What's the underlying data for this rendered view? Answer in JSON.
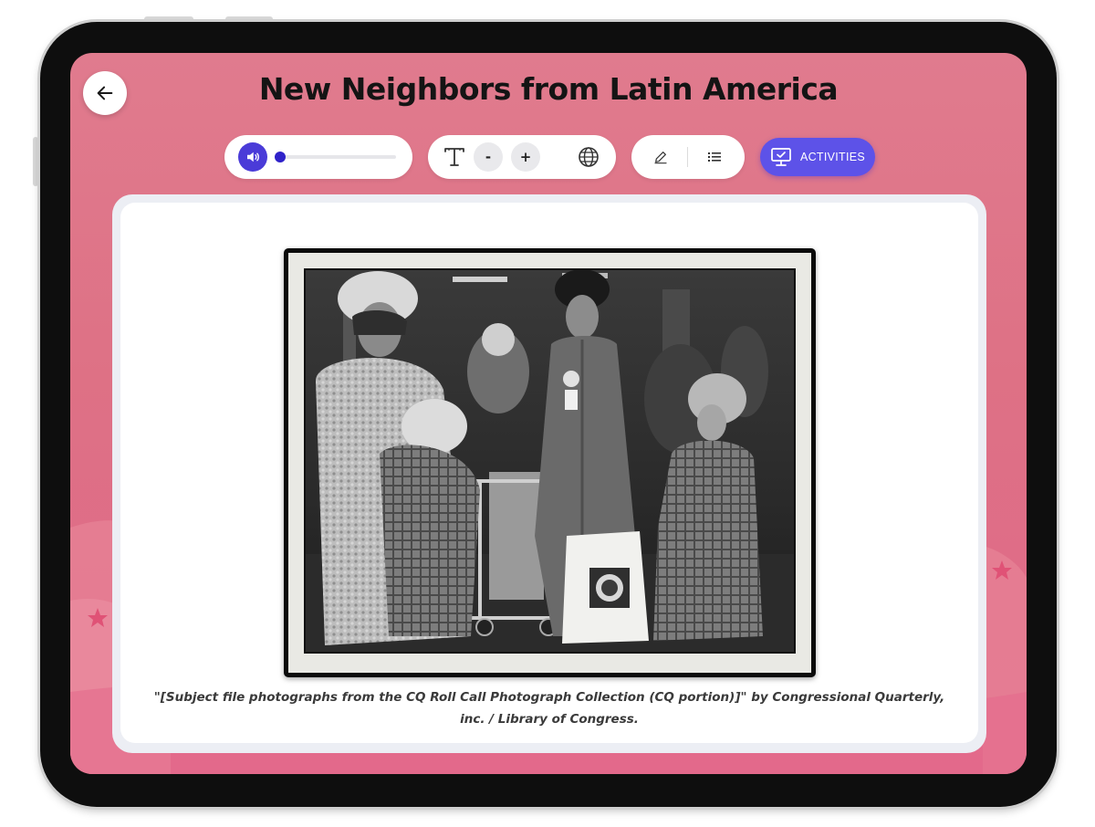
{
  "page": {
    "title": "New Neighbors from Latin America"
  },
  "header": {
    "back_icon": "arrow-left-icon"
  },
  "toolbar": {
    "audio": {
      "play_icon": "speaker-icon",
      "progress": 0.02
    },
    "text_controls": {
      "text_size_icon": "text-size-icon",
      "decrease_label": "-",
      "increase_label": "+",
      "language_icon": "globe-icon"
    },
    "tools": {
      "highlight_icon": "pencil-icon",
      "outline_icon": "list-icon"
    },
    "activities": {
      "label": "ACTIVITIES",
      "icon": "monitor-check-icon"
    }
  },
  "content": {
    "image_alt_icon": "photo-image",
    "caption": "\"[Subject file photographs from the CQ Roll Call Photograph Collection (CQ portion)]\" by Congressional Quarterly, inc. / Library of Congress."
  },
  "colors": {
    "background": "#de7185",
    "accent": "#5d52e8",
    "audio_button": "#4a3bd8",
    "star_decoration": "#e05276"
  }
}
